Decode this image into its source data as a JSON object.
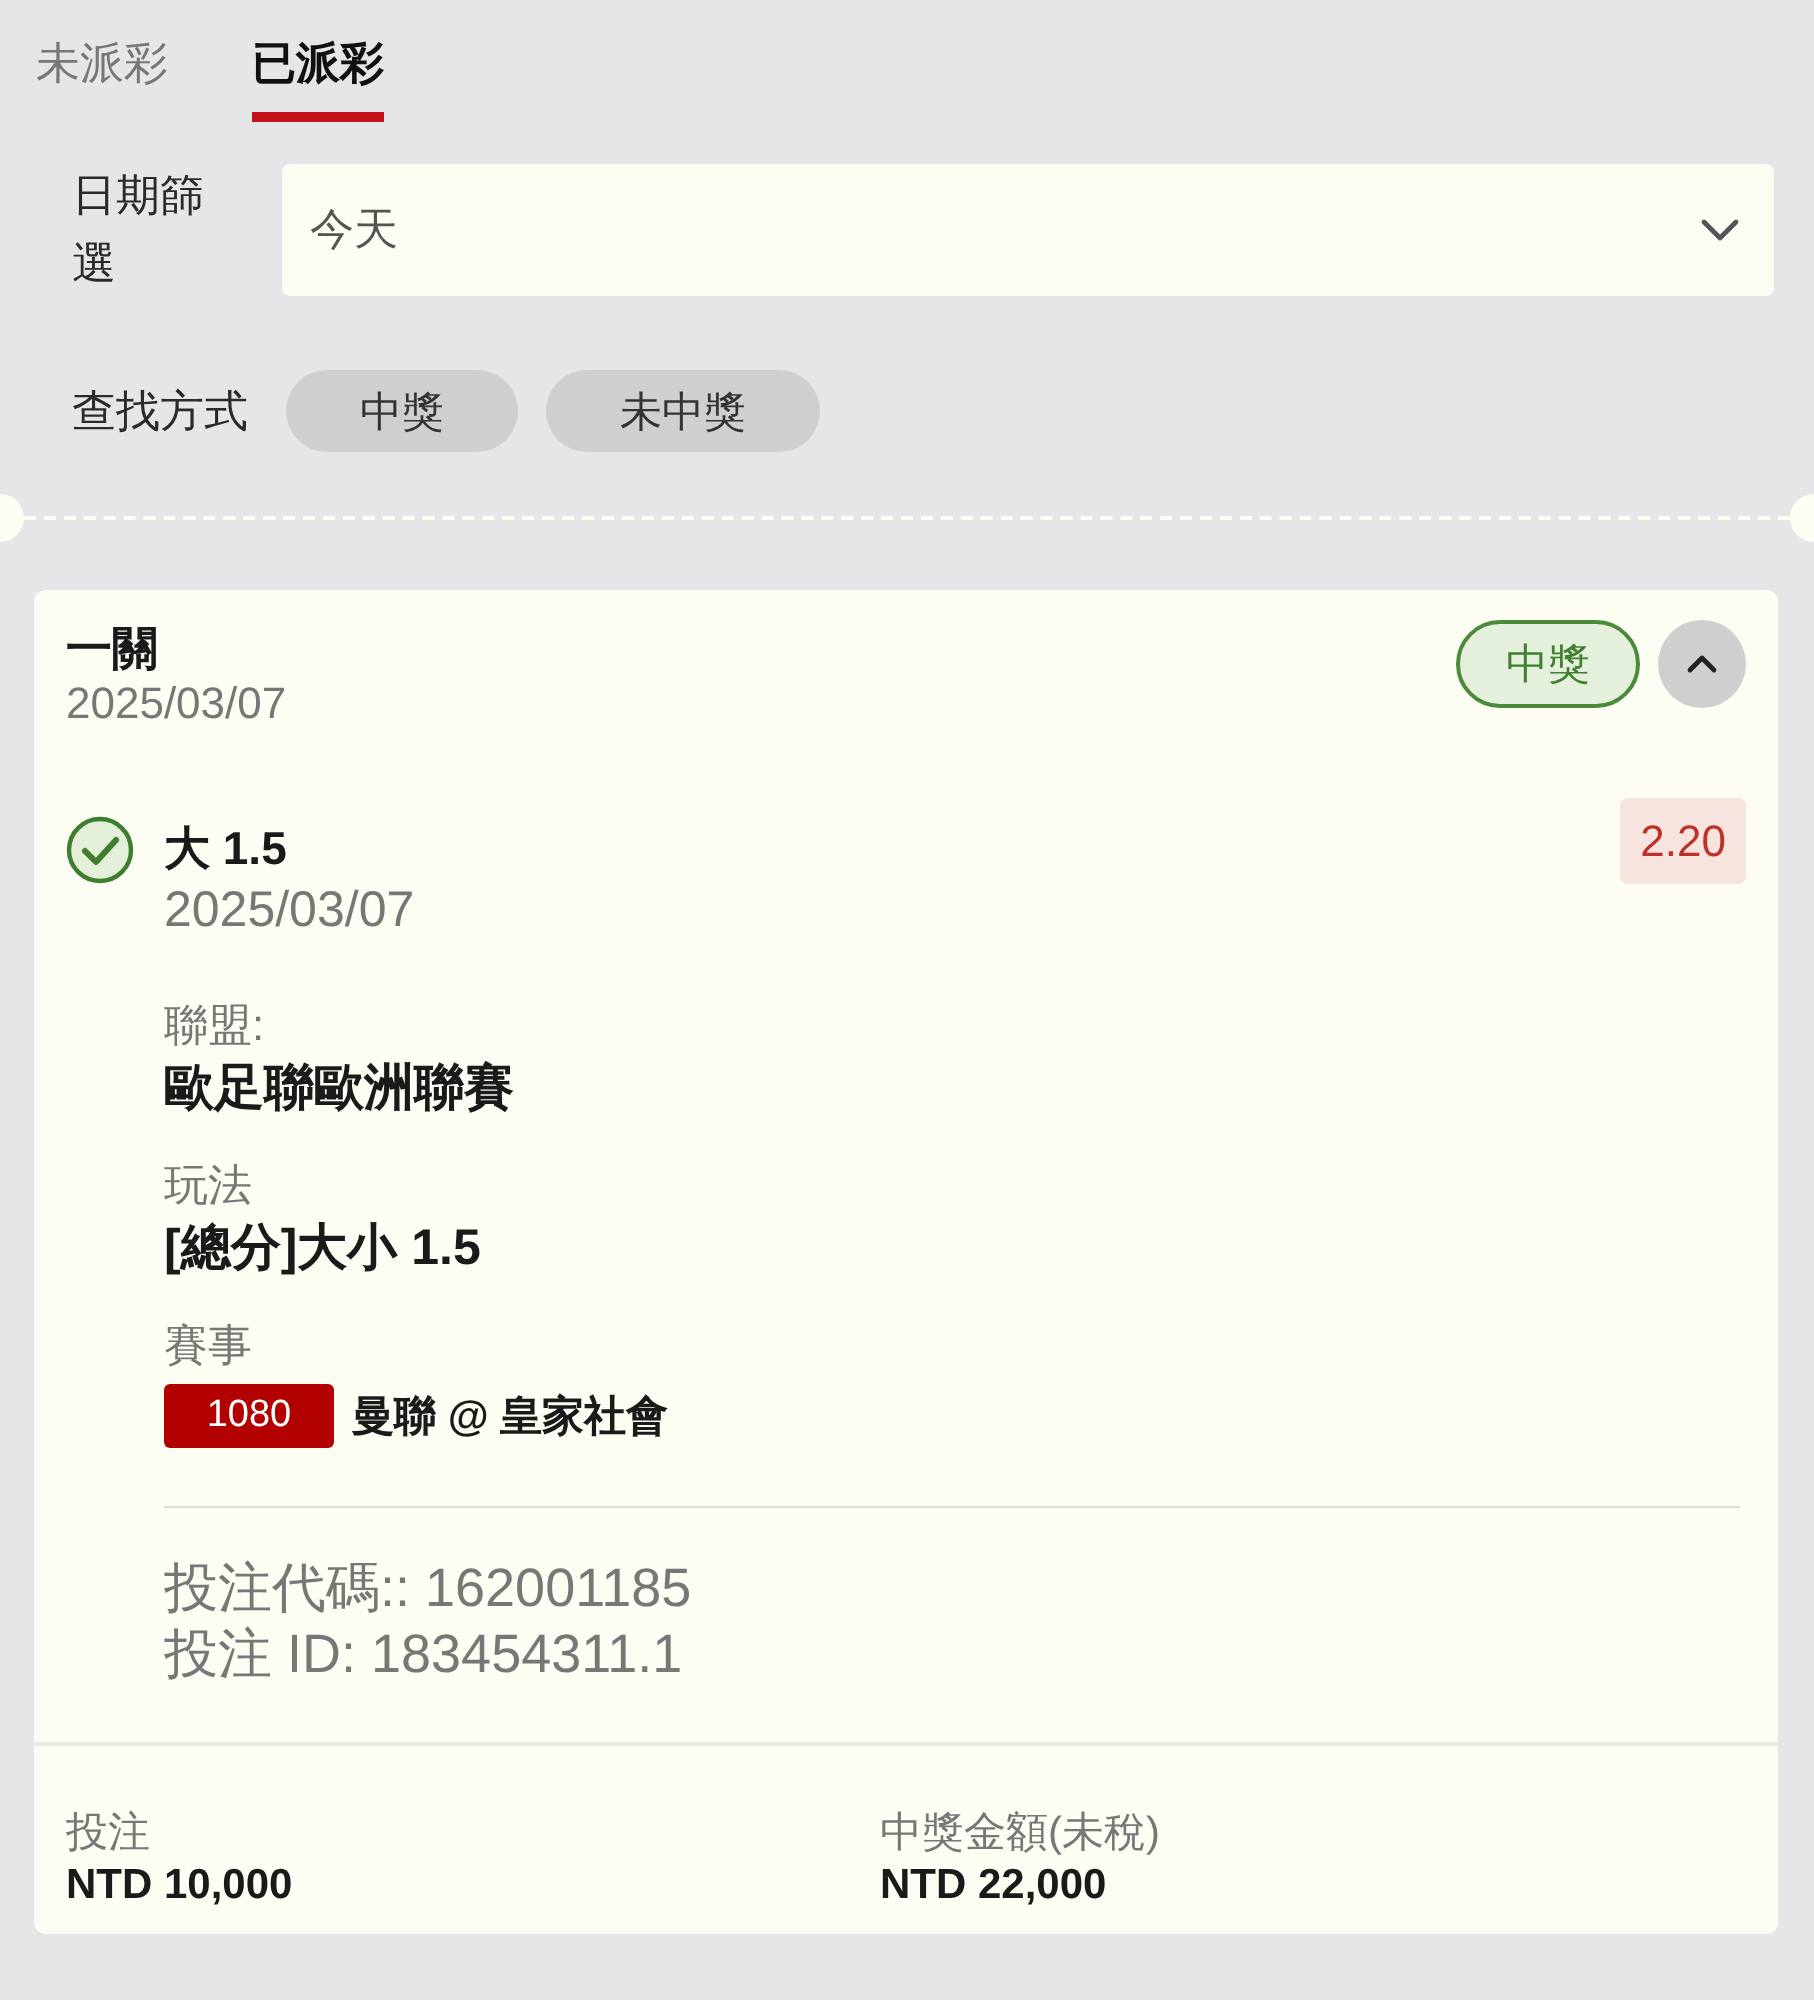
{
  "tabs": [
    {
      "label": "未派彩",
      "selected": false
    },
    {
      "label": "已派彩",
      "selected": true
    }
  ],
  "date_filter": {
    "label": "日期篩選",
    "value": "今天"
  },
  "search_mode": {
    "label": "查找方式",
    "options": [
      {
        "label": "中獎",
        "selected": false
      },
      {
        "label": "未中獎",
        "selected": false
      }
    ]
  },
  "bet_card": {
    "title": "一關",
    "date": "2025/03/07",
    "status": {
      "label": "中獎",
      "kind": "won"
    },
    "expanded": true,
    "selections": [
      {
        "won": true,
        "pick": "大 1.5",
        "date": "2025/03/07",
        "odds": "2.20",
        "league_label": "聯盟:",
        "league": "歐足聯歐洲聯賽",
        "market_label": "玩法",
        "market": "[總分]大小 1.5",
        "event_label": "賽事",
        "event_code": "1080",
        "event": "曼聯 @ 皇家社會",
        "bet_code": "投注代碼:: 162001185",
        "bet_id": "投注 ID: 183454311.1"
      }
    ],
    "footer": [
      {
        "label": "投注",
        "value": "NTD 10,000"
      },
      {
        "label": "中獎金額(未稅)",
        "value": "NTD 22,000"
      }
    ]
  }
}
